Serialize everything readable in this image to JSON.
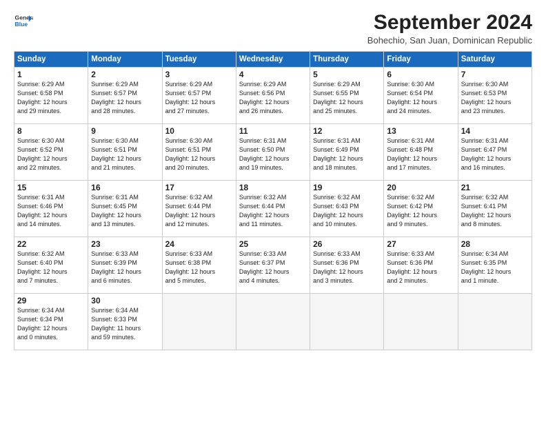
{
  "header": {
    "logo_line1": "General",
    "logo_line2": "Blue",
    "month": "September 2024",
    "location": "Bohechio, San Juan, Dominican Republic"
  },
  "days_of_week": [
    "Sunday",
    "Monday",
    "Tuesday",
    "Wednesday",
    "Thursday",
    "Friday",
    "Saturday"
  ],
  "weeks": [
    [
      {
        "day": "1",
        "lines": [
          "Sunrise: 6:29 AM",
          "Sunset: 6:58 PM",
          "Daylight: 12 hours",
          "and 29 minutes."
        ]
      },
      {
        "day": "2",
        "lines": [
          "Sunrise: 6:29 AM",
          "Sunset: 6:57 PM",
          "Daylight: 12 hours",
          "and 28 minutes."
        ]
      },
      {
        "day": "3",
        "lines": [
          "Sunrise: 6:29 AM",
          "Sunset: 6:57 PM",
          "Daylight: 12 hours",
          "and 27 minutes."
        ]
      },
      {
        "day": "4",
        "lines": [
          "Sunrise: 6:29 AM",
          "Sunset: 6:56 PM",
          "Daylight: 12 hours",
          "and 26 minutes."
        ]
      },
      {
        "day": "5",
        "lines": [
          "Sunrise: 6:29 AM",
          "Sunset: 6:55 PM",
          "Daylight: 12 hours",
          "and 25 minutes."
        ]
      },
      {
        "day": "6",
        "lines": [
          "Sunrise: 6:30 AM",
          "Sunset: 6:54 PM",
          "Daylight: 12 hours",
          "and 24 minutes."
        ]
      },
      {
        "day": "7",
        "lines": [
          "Sunrise: 6:30 AM",
          "Sunset: 6:53 PM",
          "Daylight: 12 hours",
          "and 23 minutes."
        ]
      }
    ],
    [
      {
        "day": "8",
        "lines": [
          "Sunrise: 6:30 AM",
          "Sunset: 6:52 PM",
          "Daylight: 12 hours",
          "and 22 minutes."
        ]
      },
      {
        "day": "9",
        "lines": [
          "Sunrise: 6:30 AM",
          "Sunset: 6:51 PM",
          "Daylight: 12 hours",
          "and 21 minutes."
        ]
      },
      {
        "day": "10",
        "lines": [
          "Sunrise: 6:30 AM",
          "Sunset: 6:51 PM",
          "Daylight: 12 hours",
          "and 20 minutes."
        ]
      },
      {
        "day": "11",
        "lines": [
          "Sunrise: 6:31 AM",
          "Sunset: 6:50 PM",
          "Daylight: 12 hours",
          "and 19 minutes."
        ]
      },
      {
        "day": "12",
        "lines": [
          "Sunrise: 6:31 AM",
          "Sunset: 6:49 PM",
          "Daylight: 12 hours",
          "and 18 minutes."
        ]
      },
      {
        "day": "13",
        "lines": [
          "Sunrise: 6:31 AM",
          "Sunset: 6:48 PM",
          "Daylight: 12 hours",
          "and 17 minutes."
        ]
      },
      {
        "day": "14",
        "lines": [
          "Sunrise: 6:31 AM",
          "Sunset: 6:47 PM",
          "Daylight: 12 hours",
          "and 16 minutes."
        ]
      }
    ],
    [
      {
        "day": "15",
        "lines": [
          "Sunrise: 6:31 AM",
          "Sunset: 6:46 PM",
          "Daylight: 12 hours",
          "and 14 minutes."
        ]
      },
      {
        "day": "16",
        "lines": [
          "Sunrise: 6:31 AM",
          "Sunset: 6:45 PM",
          "Daylight: 12 hours",
          "and 13 minutes."
        ]
      },
      {
        "day": "17",
        "lines": [
          "Sunrise: 6:32 AM",
          "Sunset: 6:44 PM",
          "Daylight: 12 hours",
          "and 12 minutes."
        ]
      },
      {
        "day": "18",
        "lines": [
          "Sunrise: 6:32 AM",
          "Sunset: 6:44 PM",
          "Daylight: 12 hours",
          "and 11 minutes."
        ]
      },
      {
        "day": "19",
        "lines": [
          "Sunrise: 6:32 AM",
          "Sunset: 6:43 PM",
          "Daylight: 12 hours",
          "and 10 minutes."
        ]
      },
      {
        "day": "20",
        "lines": [
          "Sunrise: 6:32 AM",
          "Sunset: 6:42 PM",
          "Daylight: 12 hours",
          "and 9 minutes."
        ]
      },
      {
        "day": "21",
        "lines": [
          "Sunrise: 6:32 AM",
          "Sunset: 6:41 PM",
          "Daylight: 12 hours",
          "and 8 minutes."
        ]
      }
    ],
    [
      {
        "day": "22",
        "lines": [
          "Sunrise: 6:32 AM",
          "Sunset: 6:40 PM",
          "Daylight: 12 hours",
          "and 7 minutes."
        ]
      },
      {
        "day": "23",
        "lines": [
          "Sunrise: 6:33 AM",
          "Sunset: 6:39 PM",
          "Daylight: 12 hours",
          "and 6 minutes."
        ]
      },
      {
        "day": "24",
        "lines": [
          "Sunrise: 6:33 AM",
          "Sunset: 6:38 PM",
          "Daylight: 12 hours",
          "and 5 minutes."
        ]
      },
      {
        "day": "25",
        "lines": [
          "Sunrise: 6:33 AM",
          "Sunset: 6:37 PM",
          "Daylight: 12 hours",
          "and 4 minutes."
        ]
      },
      {
        "day": "26",
        "lines": [
          "Sunrise: 6:33 AM",
          "Sunset: 6:36 PM",
          "Daylight: 12 hours",
          "and 3 minutes."
        ]
      },
      {
        "day": "27",
        "lines": [
          "Sunrise: 6:33 AM",
          "Sunset: 6:36 PM",
          "Daylight: 12 hours",
          "and 2 minutes."
        ]
      },
      {
        "day": "28",
        "lines": [
          "Sunrise: 6:34 AM",
          "Sunset: 6:35 PM",
          "Daylight: 12 hours",
          "and 1 minute."
        ]
      }
    ],
    [
      {
        "day": "29",
        "lines": [
          "Sunrise: 6:34 AM",
          "Sunset: 6:34 PM",
          "Daylight: 12 hours",
          "and 0 minutes."
        ]
      },
      {
        "day": "30",
        "lines": [
          "Sunrise: 6:34 AM",
          "Sunset: 6:33 PM",
          "Daylight: 11 hours",
          "and 59 minutes."
        ]
      },
      {
        "day": "",
        "lines": []
      },
      {
        "day": "",
        "lines": []
      },
      {
        "day": "",
        "lines": []
      },
      {
        "day": "",
        "lines": []
      },
      {
        "day": "",
        "lines": []
      }
    ]
  ]
}
